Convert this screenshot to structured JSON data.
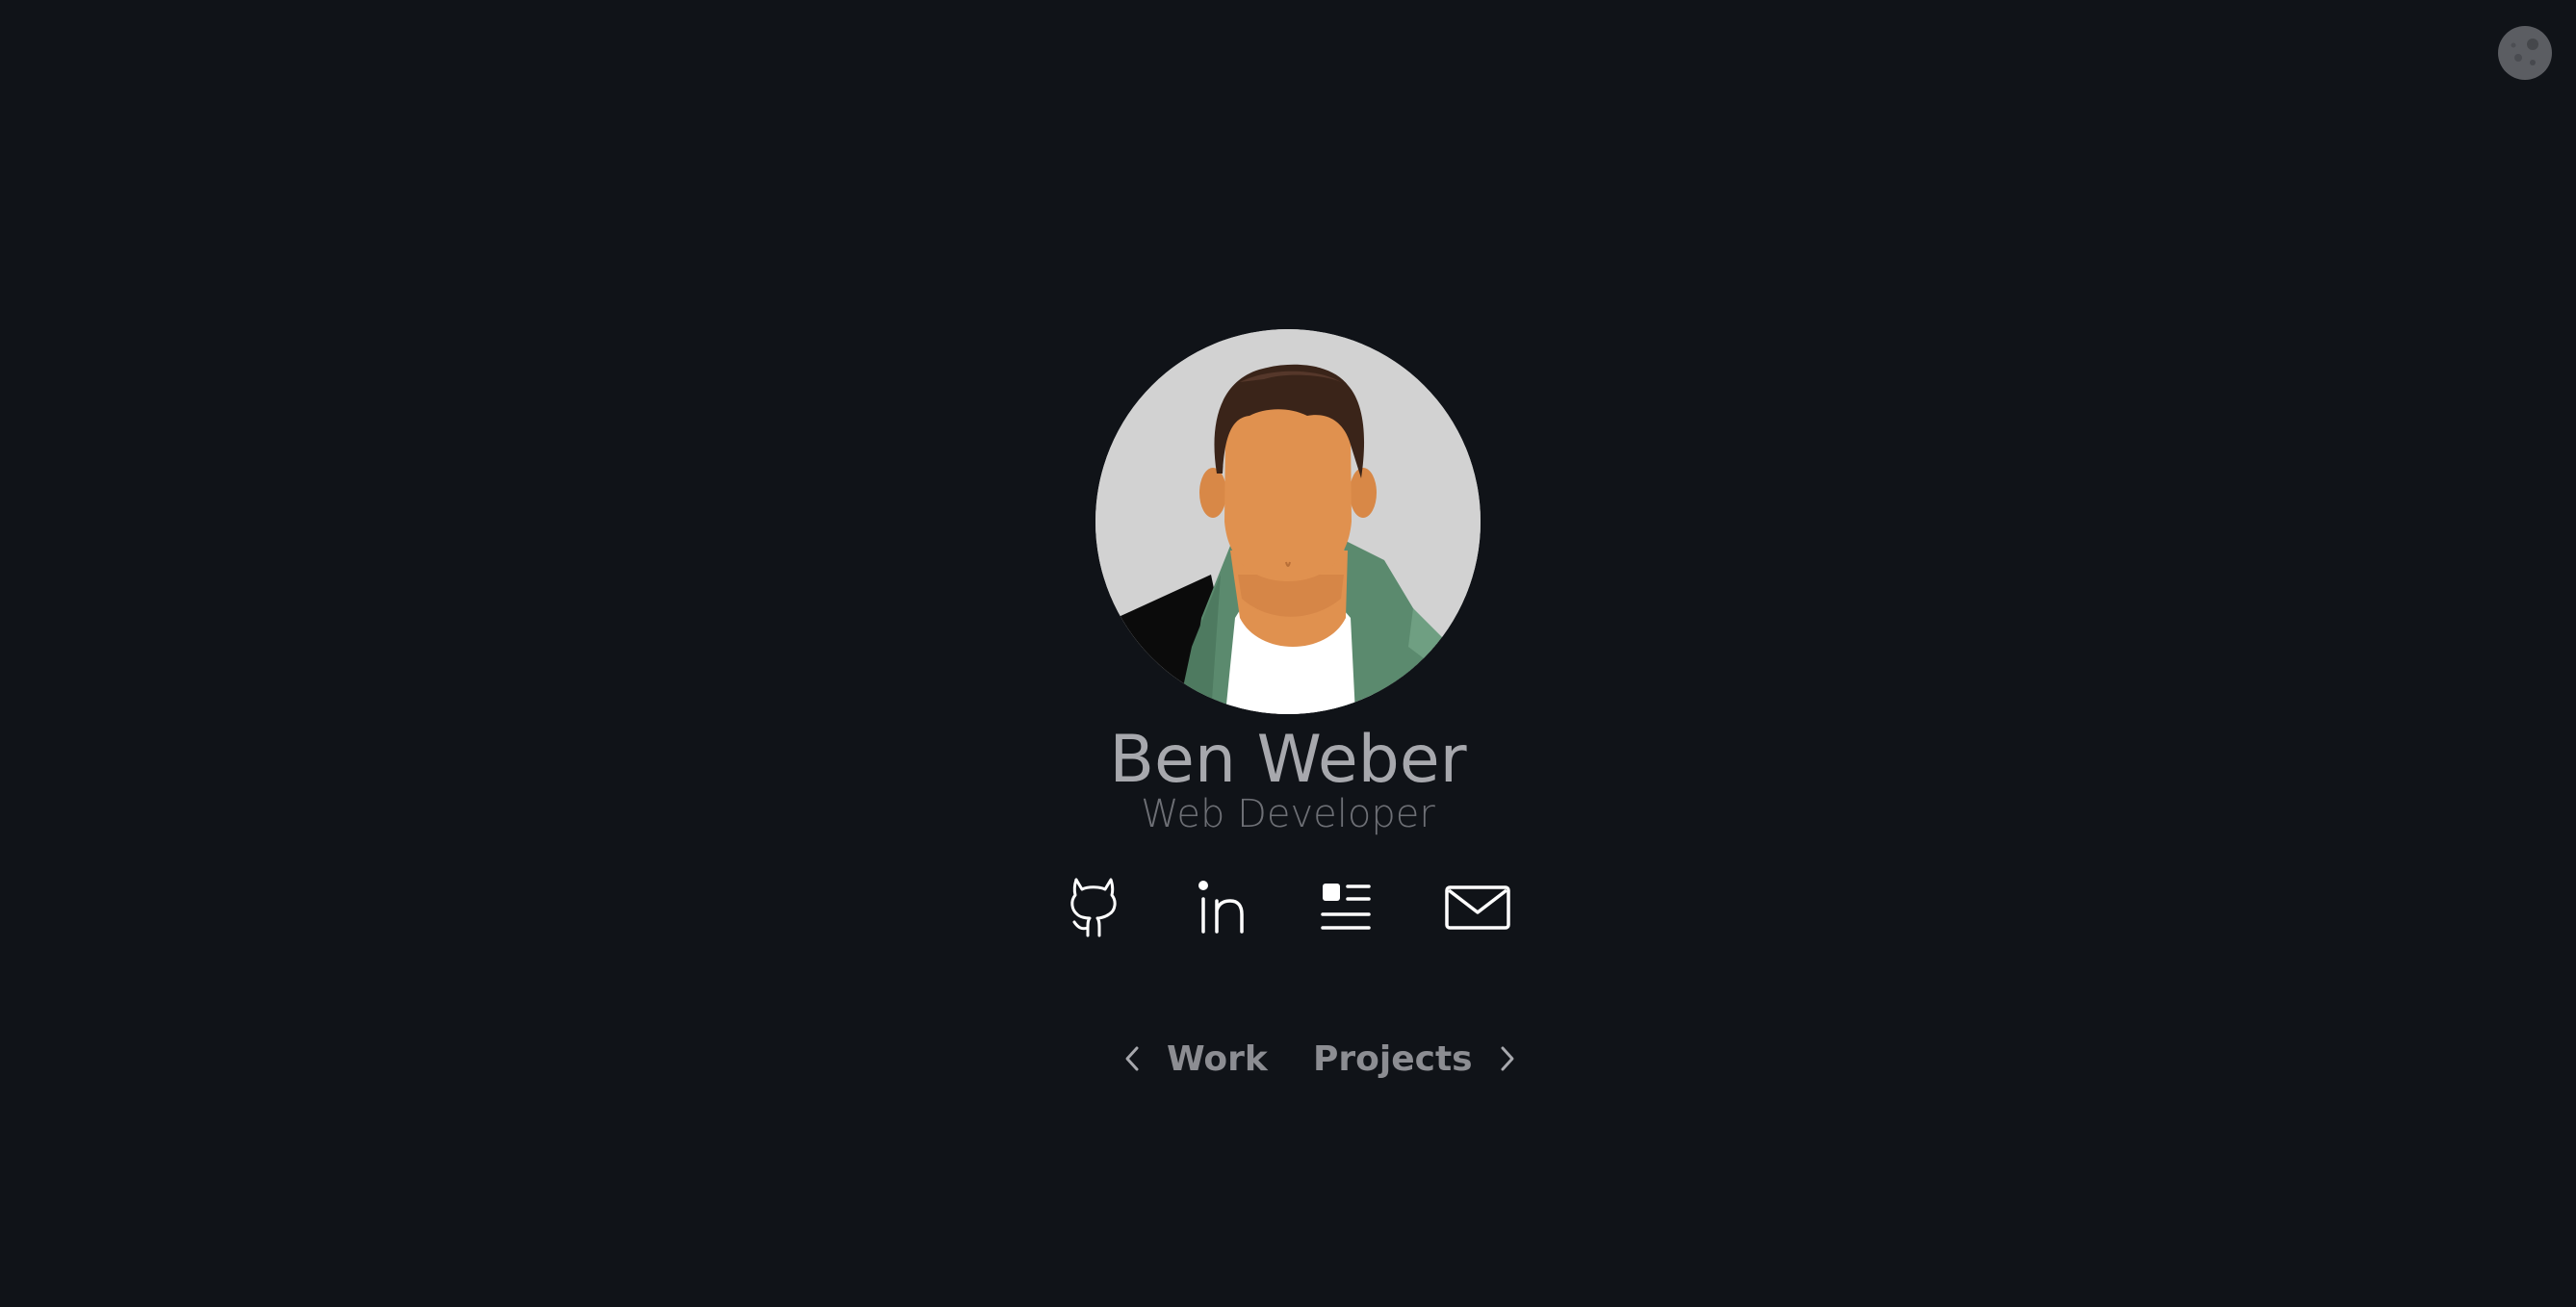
{
  "theme_toggle": {
    "icon": "moon-icon"
  },
  "profile": {
    "avatar": {
      "icon": "avatar-illustration"
    },
    "name": "Ben Weber",
    "role": "Web Developer"
  },
  "socials": [
    {
      "icon": "github-icon"
    },
    {
      "icon": "linkedin-icon"
    },
    {
      "icon": "resume-icon"
    },
    {
      "icon": "mail-icon"
    }
  ],
  "nav": {
    "prev_label": "Work",
    "next_label": "Projects"
  },
  "colors": {
    "background": "#101318",
    "name_text": "#a7a8ad",
    "role_text": "#6d6f75",
    "icon_stroke": "#ffffff",
    "nav_text": "#8c8d92"
  }
}
